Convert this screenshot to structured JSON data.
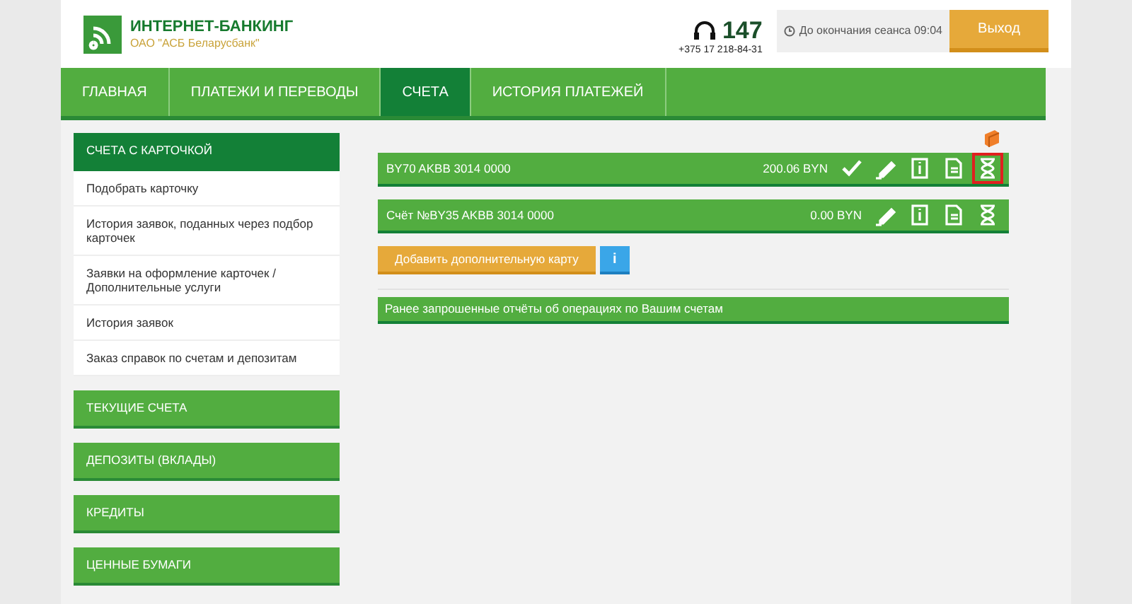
{
  "header": {
    "brand": "ИНТЕРНЕТ-БАНКИНГ",
    "bank": "ОАО \"АСБ Беларусбанк\"",
    "hotline": "147",
    "phone": "+375 17 218-84-31",
    "session": "До окончания сеанса 09:04",
    "logout": "Выход"
  },
  "tabs": [
    {
      "label": "ГЛАВНАЯ",
      "selected": false
    },
    {
      "label": "ПЛАТЕЖИ И ПЕРЕВОДЫ",
      "selected": false
    },
    {
      "label": "СЧЕТА",
      "selected": true
    },
    {
      "label": "ИСТОРИЯ ПЛАТЕЖЕЙ",
      "selected": false
    }
  ],
  "sidebar": {
    "sections": [
      {
        "title": "СЧЕТА С КАРТОЧКОЙ",
        "expanded": true,
        "items": [
          "Подобрать карточку",
          "История заявок, поданных через подбор карточек",
          "Заявки на оформление карточек / Дополнительные услуги",
          "История заявок",
          "Заказ справок по счетам и депозитам"
        ]
      },
      {
        "title": "ТЕКУЩИЕ СЧЕТА",
        "expanded": false
      },
      {
        "title": "ДЕПОЗИТЫ (ВКЛАДЫ)",
        "expanded": false
      },
      {
        "title": "КРЕДИТЫ",
        "expanded": false
      },
      {
        "title": "ЦЕННЫЕ БУМАГИ",
        "expanded": false
      }
    ]
  },
  "accounts": [
    {
      "name": "BY70 AKBB 3014 0000",
      "balance": "200.06 BYN",
      "actions": [
        {
          "kind": "check",
          "highlighted": false
        },
        {
          "kind": "edit",
          "highlighted": false
        },
        {
          "kind": "info",
          "highlighted": false
        },
        {
          "kind": "document",
          "highlighted": false
        },
        {
          "kind": "hourglass",
          "highlighted": true
        }
      ]
    },
    {
      "name": "Счёт №BY35 AKBB 3014 0000",
      "balance": "0.00 BYN",
      "actions": [
        {
          "kind": "edit",
          "highlighted": false
        },
        {
          "kind": "info",
          "highlighted": false
        },
        {
          "kind": "document",
          "highlighted": false
        },
        {
          "kind": "hourglass",
          "highlighted": false
        }
      ]
    }
  ],
  "add_card_button": "Добавить дополнительную карту",
  "info_button": "i",
  "reports_bar": "Ранее запрошенные отчёты об операциях по Вашим счетам"
}
